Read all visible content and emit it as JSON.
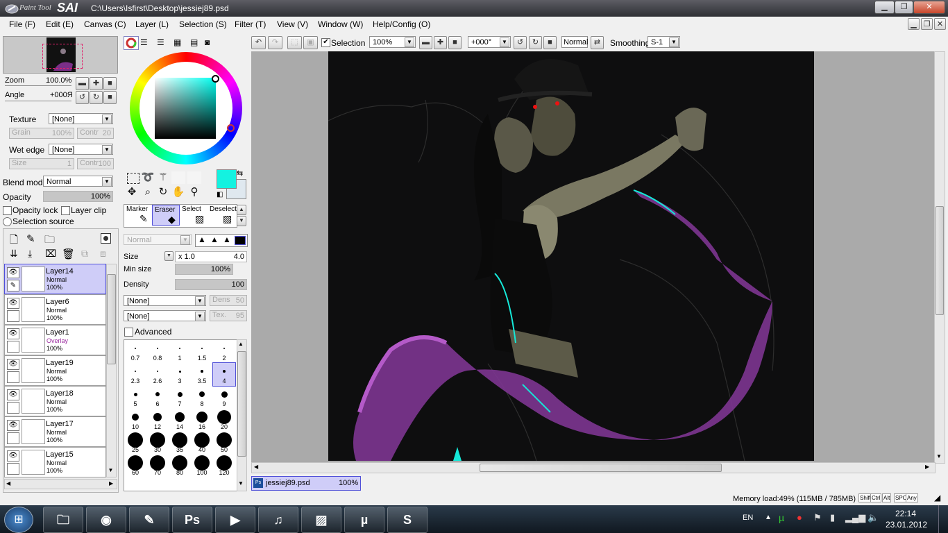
{
  "window": {
    "app_logo_small": "Paint Tool",
    "app_logo_big": "SAI",
    "title": "C:\\Users\\Isfirst\\Desktop\\jessiej89.psd"
  },
  "menu": [
    "File (F)",
    "Edit (E)",
    "Canvas (C)",
    "Layer (L)",
    "Selection (S)",
    "Filter (T)",
    "View (V)",
    "Window (W)",
    "Help/Config (O)"
  ],
  "navigator": {
    "zoom_label": "Zoom",
    "zoom_value": "100.0%",
    "angle_label": "Angle",
    "angle_value": "+000Я"
  },
  "texture": {
    "texture_label": "Texture",
    "texture_value": "[None]",
    "grain_label": "Grain",
    "grain_value": "100%",
    "contr_label": "Contr",
    "contr_value": "20",
    "wet_label": "Wet edge",
    "wet_value": "[None]",
    "size_label": "Size",
    "size_value": "1",
    "contr2_label": "Contr",
    "contr2_value": "100"
  },
  "blend": {
    "blend_label": "Blend mode",
    "blend_value": "Normal",
    "opacity_label": "Opacity",
    "opacity_value": "100%",
    "opacity_lock": "Opacity lock",
    "layer_clip": "Layer clip",
    "selection_source": "Selection source"
  },
  "layers": [
    {
      "name": "Layer14",
      "mode": "Normal",
      "opacity": "100%",
      "selected": true
    },
    {
      "name": "Layer6",
      "mode": "Normal",
      "opacity": "100%",
      "selected": false
    },
    {
      "name": "Layer1",
      "mode": "Overlay",
      "opacity": "100%",
      "selected": false
    },
    {
      "name": "Layer19",
      "mode": "Normal",
      "opacity": "100%",
      "selected": false
    },
    {
      "name": "Layer18",
      "mode": "Normal",
      "opacity": "100%",
      "selected": false
    },
    {
      "name": "Layer17",
      "mode": "Normal",
      "opacity": "100%",
      "selected": false
    },
    {
      "name": "Layer15",
      "mode": "Normal",
      "opacity": "100%",
      "selected": false
    }
  ],
  "colors": {
    "primary": "#14f2e0",
    "secondary": "#dfe8ef",
    "overlay_mode_color": "#9b2ca0",
    "selected_layer_bg": "#cfcdf8"
  },
  "tools": {
    "marker": "Marker",
    "eraser": "Eraser",
    "select": "Select",
    "deselect": "Deselect",
    "mode_value": "Normal",
    "size_label": "Size",
    "size_mult": "x 1.0",
    "size_value": "4.0",
    "minsize_label": "Min size",
    "minsize_value": "100%",
    "density_label": "Density",
    "density_value": "100",
    "shape_value": "[None]",
    "dens_label": "Dens",
    "dens_value": "50",
    "texture_value": "[None]",
    "tex_label": "Tex.",
    "tex_value": "95",
    "advanced_label": "Advanced"
  },
  "brush_sizes": [
    "0.7",
    "0.8",
    "1",
    "1.5",
    "2",
    "2.3",
    "2.6",
    "3",
    "3.5",
    "4",
    "5",
    "6",
    "7",
    "8",
    "9",
    "10",
    "12",
    "14",
    "16",
    "20",
    "25",
    "30",
    "35",
    "40",
    "50",
    "60",
    "70",
    "80",
    "100",
    "120"
  ],
  "selected_brush_size": "4",
  "toolbar": {
    "selection_label": "Selection",
    "zoom_value": "100%",
    "angle_value": "+000°",
    "mode_value": "Normal",
    "smoothing_label": "Smoothing",
    "smoothing_value": "S-1"
  },
  "doc_tab": {
    "name": "jessiej89.psd",
    "zoom": "100%"
  },
  "status": {
    "memory": "Memory load:49% (115MB / 785MB)",
    "keys": [
      "Shift",
      "Ctrl",
      "Alt",
      "SPC",
      "Any"
    ]
  },
  "taskbar": {
    "lang": "EN",
    "time": "22:14",
    "date": "23.01.2012",
    "apps": [
      "windows-explorer",
      "chrome",
      "paint-tool-sai",
      "photoshop",
      "media-player-classic",
      "itunes",
      "image-viewer",
      "utorrent",
      "skype"
    ]
  }
}
